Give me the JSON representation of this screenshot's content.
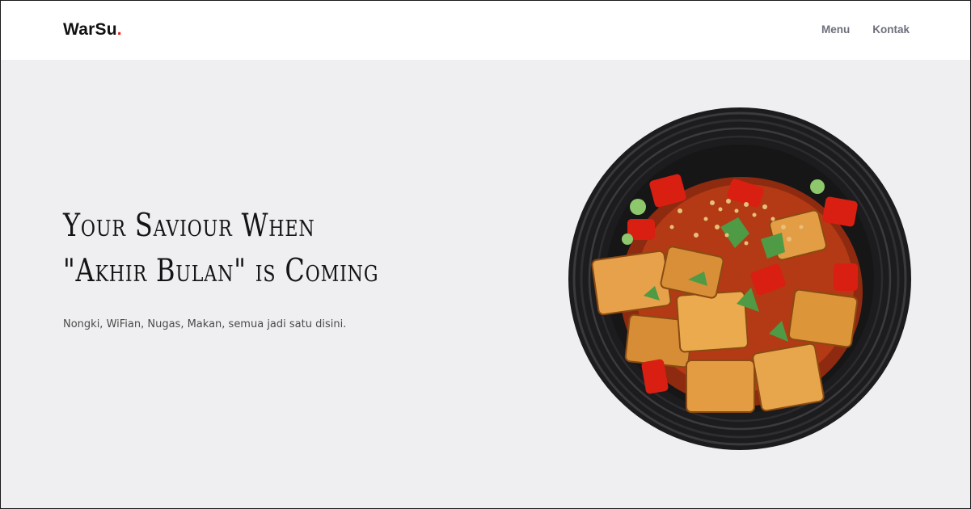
{
  "brand": {
    "name": "WarSu",
    "dot": "."
  },
  "nav": {
    "items": [
      "Menu",
      "Kontak"
    ]
  },
  "hero": {
    "headline_line1": "Your Saviour When",
    "headline_line2": "\"Akhir Bulan\" is Coming",
    "subtitle": "Nongki, WiFian, Nugas, Makan, semua jadi satu disini."
  },
  "colors": {
    "accent": "#e2231a",
    "background": "#efeff1",
    "text": "#141414",
    "nav_text": "#6d6f7c"
  },
  "image": {
    "subject": "food-bowl-image"
  }
}
